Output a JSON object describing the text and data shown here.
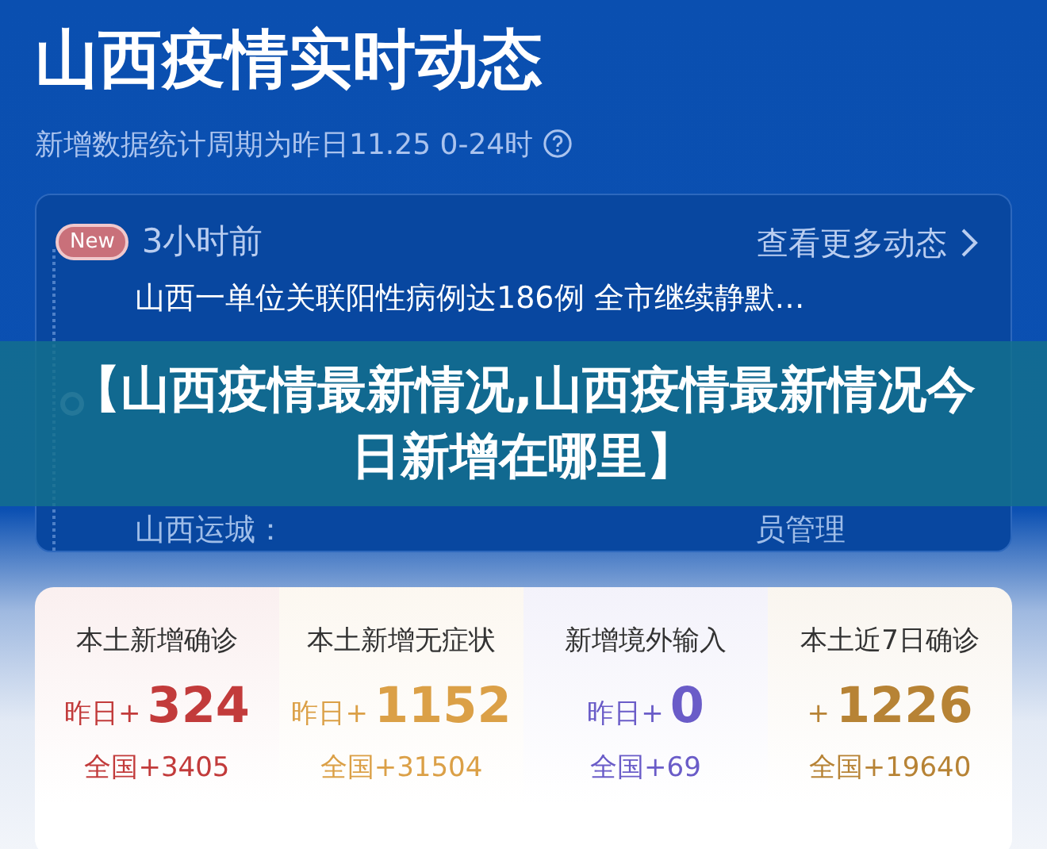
{
  "header": {
    "title": "山西疫情实时动态",
    "subtitle": "新增数据统计周期为昨日11.25 0-24时"
  },
  "timeline": {
    "more_link": "查看更多动态",
    "items": [
      {
        "badge": "New",
        "time": "3小时前",
        "headline": "山西一单位关联阳性病例达186例 全市继续静默…"
      },
      {
        "headline_fragments": [
          "山西运城：",
          "员管理"
        ]
      }
    ]
  },
  "overlay_title": "【山西疫情最新情况,山西疫情最新情况今日新增在哪里】",
  "stats": [
    {
      "label": "本土新增确诊",
      "prefix": "昨日+",
      "value": "324",
      "national": "全国+3405",
      "color": "#c23b3b"
    },
    {
      "label": "本土新增无症状",
      "prefix": "昨日+",
      "value": "1152",
      "national": "全国+31504",
      "color": "#dba047"
    },
    {
      "label": "新增境外输入",
      "prefix": "昨日+",
      "value": "0",
      "national": "全国+69",
      "color": "#6a5cc8"
    },
    {
      "label": "本土近7日确诊",
      "prefix": "+",
      "value": "1226",
      "national": "全国+19640",
      "color": "#b78335"
    }
  ]
}
